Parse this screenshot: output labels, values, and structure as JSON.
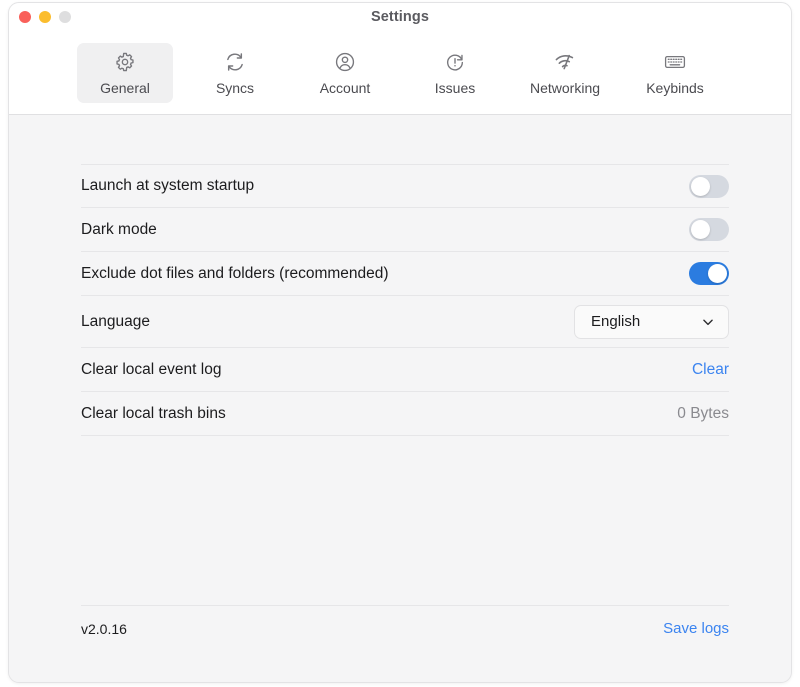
{
  "window": {
    "title": "Settings",
    "traffic_lights": [
      {
        "name": "close-button",
        "color": "#f9605a"
      },
      {
        "name": "minimize-button",
        "color": "#fbbd2e"
      },
      {
        "name": "maximize-button",
        "color": "#dededf"
      }
    ]
  },
  "toolbar": {
    "tabs": [
      {
        "label": "General",
        "icon": "gear-icon",
        "selected": true
      },
      {
        "label": "Syncs",
        "icon": "sync-icon",
        "selected": false
      },
      {
        "label": "Account",
        "icon": "account-icon",
        "selected": false
      },
      {
        "label": "Issues",
        "icon": "issues-icon",
        "selected": false
      },
      {
        "label": "Networking",
        "icon": "networking-icon",
        "selected": false
      },
      {
        "label": "Keybinds",
        "icon": "keyboard-icon",
        "selected": false
      }
    ]
  },
  "settings": {
    "rows": [
      {
        "label": "Launch at system startup",
        "control": "toggle",
        "value": "off"
      },
      {
        "label": "Dark mode",
        "control": "toggle",
        "value": "off"
      },
      {
        "label": "Exclude dot files and folders (recommended)",
        "control": "toggle",
        "value": "on"
      },
      {
        "label": "Language",
        "control": "select",
        "value": "English"
      },
      {
        "label": "Clear local event log",
        "control": "link",
        "value": "Clear"
      },
      {
        "label": "Clear local trash bins",
        "control": "text",
        "value": "0 Bytes"
      }
    ]
  },
  "footer": {
    "version": "v2.0.16",
    "save_logs_label": "Save logs"
  },
  "colors": {
    "accent": "#3b84f0",
    "toggle_on": "#2b7ce0",
    "toggle_off": "#d5d9e0",
    "content_bg": "#f5f5f6",
    "titlebar_bg": "#ffffff",
    "divider": "#e6e6e8"
  }
}
